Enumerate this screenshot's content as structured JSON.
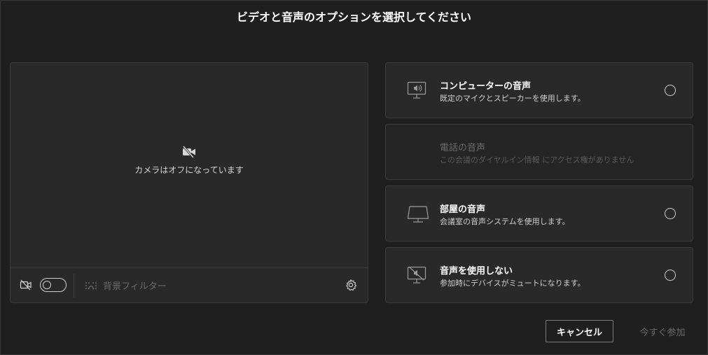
{
  "dialog": {
    "title": "ビデオと音声のオプションを選択してください"
  },
  "preview": {
    "camera_status": "カメラはオフになっています",
    "camera_icon": "video-off-icon",
    "toolbar": {
      "camera_toggle_icon": "video-off-icon",
      "background_filter_label": "背景フィルター",
      "background_filter_icon": "background-blur-icon",
      "settings_icon": "gear-icon"
    }
  },
  "audio_options": [
    {
      "title": "コンピューターの音声",
      "description": "既定のマイクとスピーカーを使用します。",
      "icon": "computer-audio-icon",
      "disabled": false
    },
    {
      "title": "電話の音声",
      "description": "この会議のダイヤルイン情報 にアクセス権がありません",
      "icon": "",
      "disabled": true
    },
    {
      "title": "部屋の音声",
      "description": "会議室の音声システムを使用します。",
      "icon": "room-audio-icon",
      "disabled": false
    },
    {
      "title": "音声を使用しない",
      "description": "参加時にデバイスがミュートになります。",
      "icon": "no-audio-icon",
      "disabled": false
    }
  ],
  "footer": {
    "cancel_label": "キャンセル",
    "join_label": "今すぐ参加"
  },
  "colors": {
    "background": "#1f1f1f",
    "panel": "#292929",
    "border": "#3b3b3b",
    "text": "#ffffff",
    "muted_text": "#6a6a6a"
  }
}
